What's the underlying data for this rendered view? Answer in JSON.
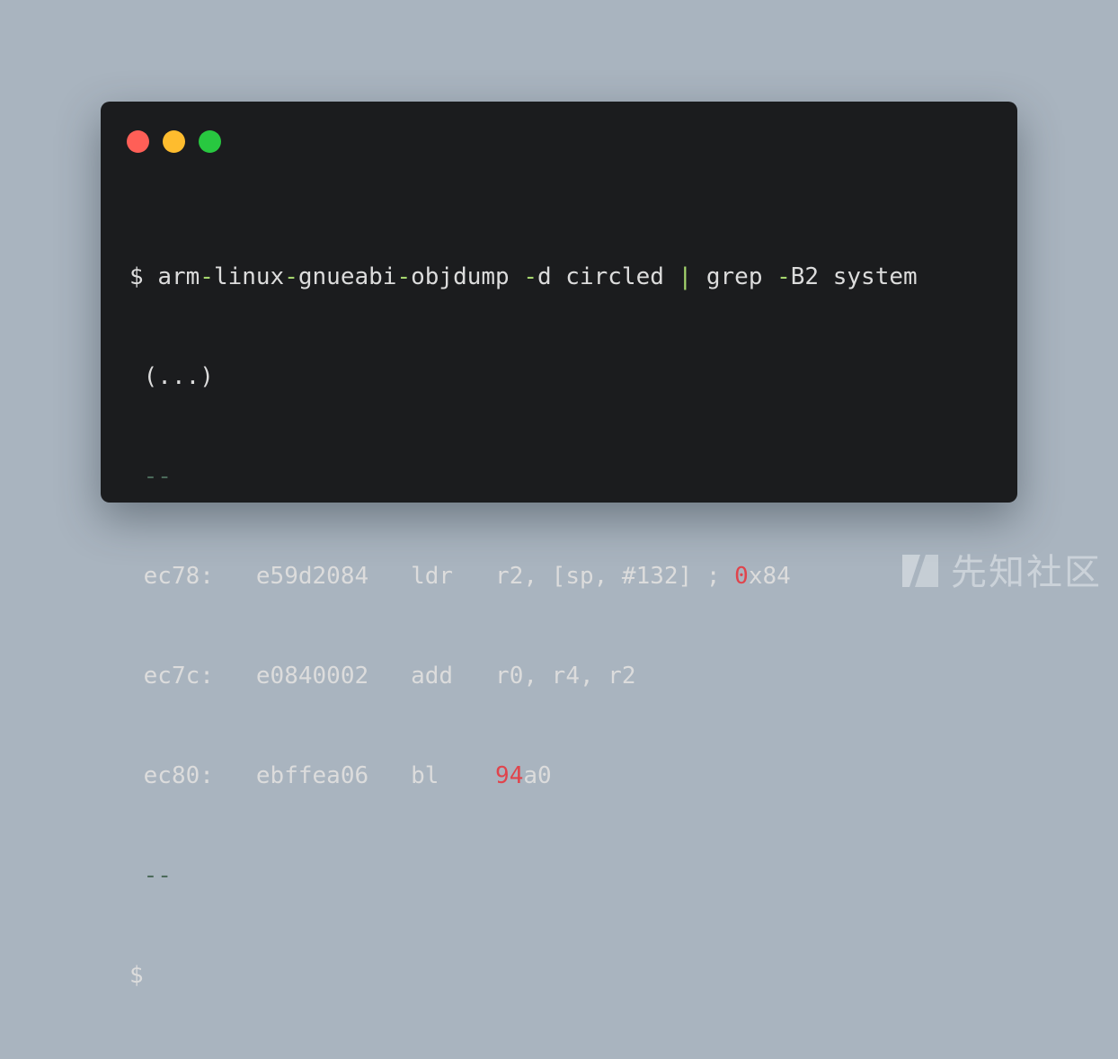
{
  "window": {
    "dots": [
      "close",
      "minimize",
      "maximize"
    ],
    "colors": {
      "background": "#1b1c1e",
      "text": "#dcdcdc",
      "operator": "#a6d76e",
      "number": "#e0444c",
      "separator": "#4c6a5a"
    }
  },
  "terminal": {
    "command": {
      "prompt": "$",
      "seg1": "arm",
      "op1": "-",
      "seg2": "linux",
      "op2": "-",
      "seg3": "gnueabi",
      "op3": "-",
      "seg4": "objdump ",
      "op4": "-",
      "seg5": "d circled ",
      "pipe": "|",
      "seg6": " grep ",
      "op5": "-",
      "seg7": "B2 system"
    },
    "ellipsis": "(...)",
    "separator_top": "--",
    "rows": [
      {
        "addr": "ec78:",
        "hex": "e59d2084",
        "mnemonic": "ldr",
        "operands_pre": "r2, [sp, #132] ; ",
        "operands_red": "0",
        "operands_post": "x84"
      },
      {
        "addr": "ec7c:",
        "hex": "e0840002",
        "mnemonic": "add",
        "operands_pre": "r0, r4, r2",
        "operands_red": "",
        "operands_post": ""
      },
      {
        "addr": "ec80:",
        "hex": "ebffea06",
        "mnemonic": "bl",
        "operands_pre": "",
        "operands_red": "94",
        "operands_post": "a0"
      }
    ],
    "separator_bottom": "--",
    "final_prompt": "$"
  },
  "watermark": {
    "text": "先知社区",
    "icon": "xianzhi-logo-icon"
  }
}
